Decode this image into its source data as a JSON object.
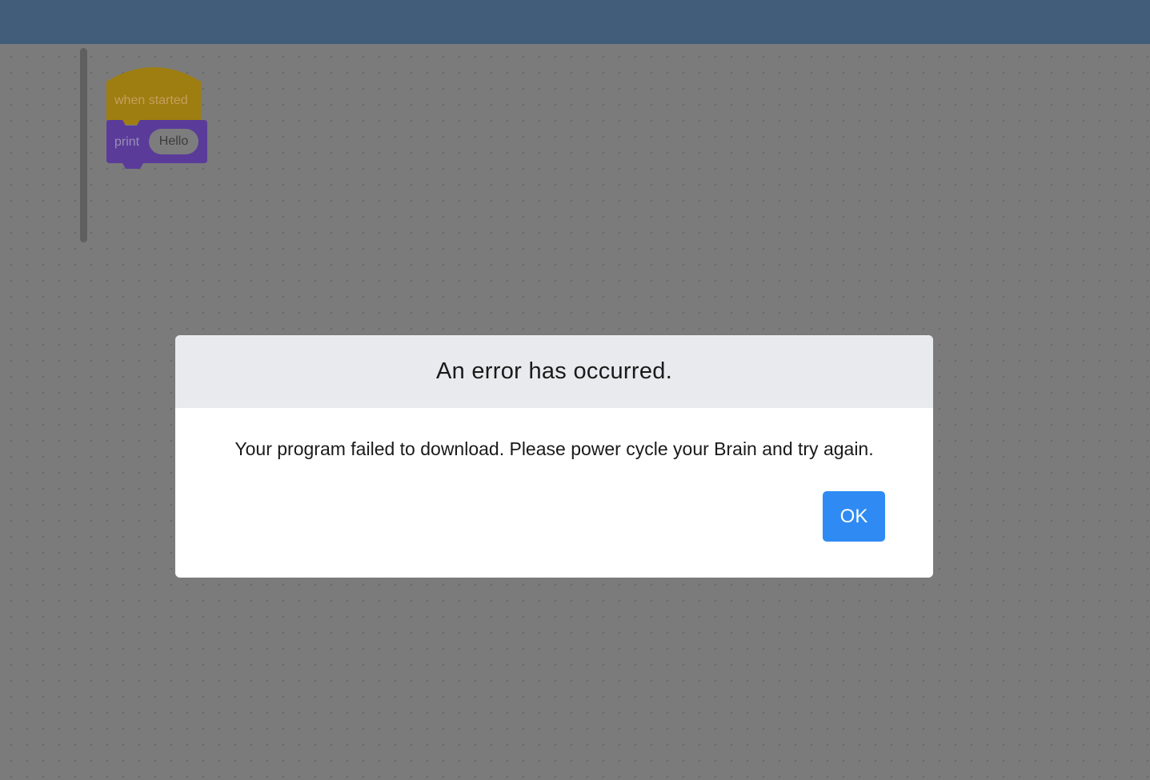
{
  "canvas": {
    "blocks": {
      "hat": {
        "label": "when started",
        "color": "#9e7d11"
      },
      "print": {
        "label": "print",
        "argument": "Hello",
        "color": "#5a3b9a"
      }
    }
  },
  "dialog": {
    "title": "An error has occurred.",
    "message": "Your program failed to download. Please power cycle your Brain and try again.",
    "ok_label": "OK",
    "button_color": "#2f8bf3"
  },
  "colors": {
    "topbar": "#425d79",
    "overlay_background": "#7b7b7b"
  }
}
